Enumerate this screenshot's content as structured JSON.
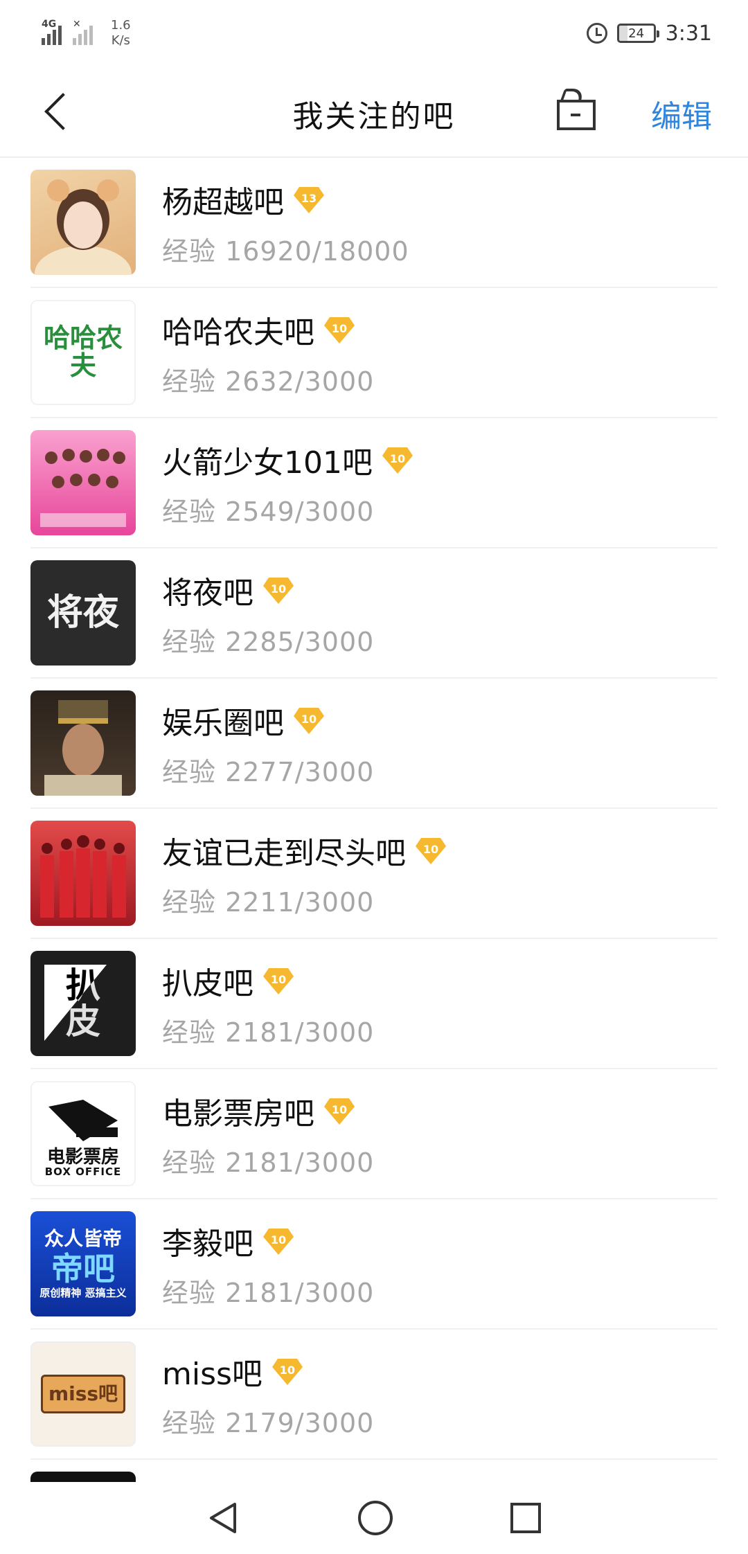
{
  "status_bar": {
    "network": "4G",
    "speed_value": "1.6",
    "speed_unit": "K/s",
    "battery": "24",
    "time": "3:31"
  },
  "header": {
    "title": "我关注的吧",
    "edit_label": "编辑"
  },
  "forums": [
    {
      "name": "杨超越吧",
      "level": "13",
      "exp": "经验 16920/18000",
      "avatar_color": "#e9c79b"
    },
    {
      "name": "哈哈农夫吧",
      "level": "10",
      "exp": "经验 2632/3000",
      "avatar_color": "#ffffff",
      "avatar_text": "哈哈农夫"
    },
    {
      "name": "火箭少女101吧",
      "level": "10",
      "exp": "经验 2549/3000",
      "avatar_color": "#e8459a"
    },
    {
      "name": "将夜吧",
      "level": "10",
      "exp": "经验 2285/3000",
      "avatar_color": "#2b2b2b",
      "avatar_text": "将夜"
    },
    {
      "name": "娱乐圈吧",
      "level": "10",
      "exp": "经验 2277/3000",
      "avatar_color": "#3a2e24"
    },
    {
      "name": "友谊已走到尽头吧",
      "level": "10",
      "exp": "经验 2211/3000",
      "avatar_color": "#c8232c"
    },
    {
      "name": "扒皮吧",
      "level": "10",
      "exp": "经验 2181/3000",
      "avatar_color": "#1e1e1e",
      "avatar_text": "扒皮"
    },
    {
      "name": "电影票房吧",
      "level": "10",
      "exp": "经验 2181/3000",
      "avatar_color": "#ffffff",
      "avatar_text": "电影票房",
      "avatar_sub": "BOX OFFICE"
    },
    {
      "name": "李毅吧",
      "level": "10",
      "exp": "经验 2181/3000",
      "avatar_color": "#1a4fd6",
      "avatar_text": "众人皆帝",
      "avatar_sub": "帝吧",
      "avatar_sub2": "原创精神 恶搞主义"
    },
    {
      "name": "miss吧",
      "level": "10",
      "exp": "经验 2179/3000",
      "avatar_color": "#f7f0e6",
      "avatar_text": "miss吧"
    }
  ],
  "colors": {
    "accent": "#2e86de",
    "level_badge": "#f5b82e",
    "exp_text": "#a6a6a6"
  },
  "icons": {
    "back": "chevron-left-icon",
    "bag": "shopping-bag-icon",
    "sys_back": "triangle-back-icon",
    "sys_home": "circle-home-icon",
    "sys_recent": "square-recent-icon"
  }
}
